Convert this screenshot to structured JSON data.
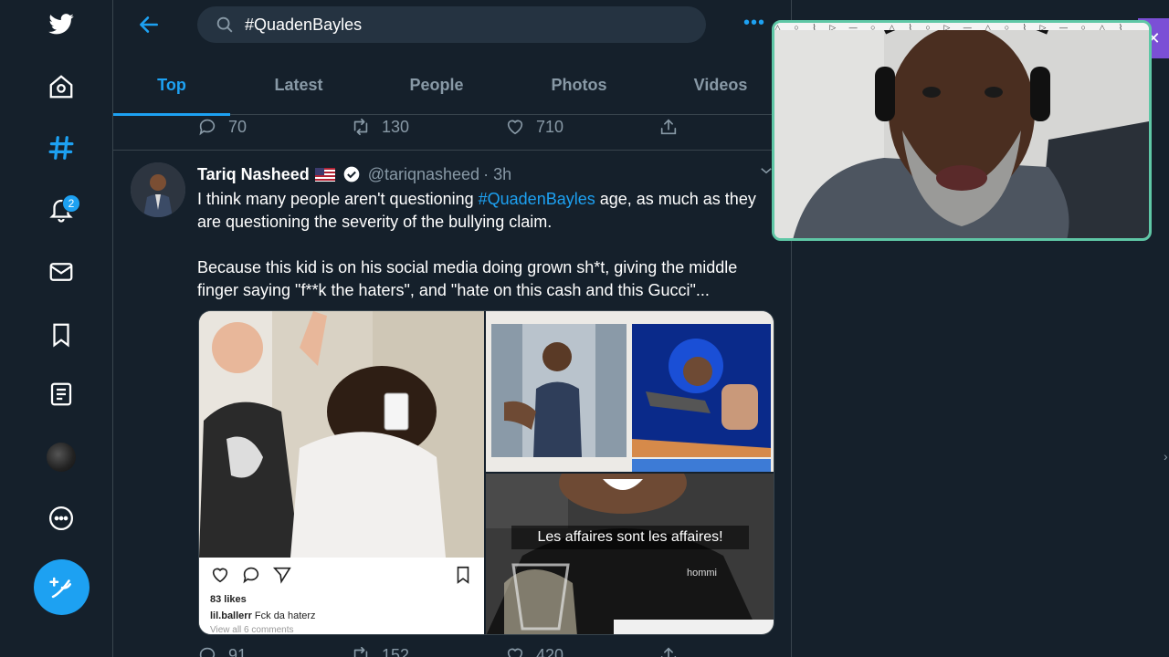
{
  "search": {
    "value": "#QuadenBayles"
  },
  "nav": {
    "notifications_badge": "2"
  },
  "tabs": [
    {
      "label": "Top",
      "active": true
    },
    {
      "label": "Latest"
    },
    {
      "label": "People"
    },
    {
      "label": "Photos"
    },
    {
      "label": "Videos"
    }
  ],
  "prev_tweet": {
    "replies": "70",
    "retweets": "130",
    "likes": "710"
  },
  "tweet": {
    "name": "Tariq Nasheed",
    "handle": "@tariqnasheed",
    "time": "· 3h",
    "line1_pre": "I think many people aren't questioning ",
    "hashtag": "#QuadenBayles",
    "line1_post": " age, as much as they",
    "line2": "are questioning the severity of the bullying claim.",
    "line3": "Because this kid is on his social media doing grown sh*t, giving the middle",
    "line4": "finger saying \"f**k the haters\", and \"hate on this cash and this Gucci\"...",
    "replies": "91",
    "retweets": "152",
    "likes": "420"
  },
  "media": {
    "insta_likes": "83 likes",
    "insta_user": "lil.ballerr",
    "insta_caption": " Fck da haterz",
    "insta_comments": "View all 6 comments",
    "overlay_caption": "Les affaires sont les affaires!",
    "shirt_brand": "hommi"
  },
  "colors": {
    "accent": "#1da1f2",
    "background": "#15202b",
    "border": "#38444d",
    "muted": "#8899a6",
    "webcam_border": "#5fc7a6"
  }
}
